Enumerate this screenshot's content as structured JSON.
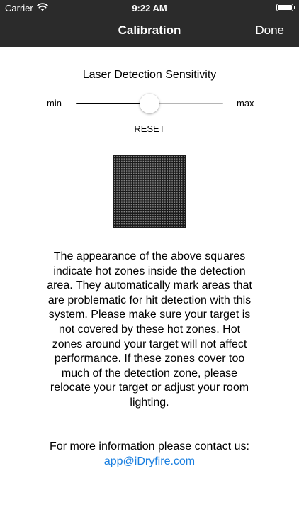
{
  "status_bar": {
    "carrier": "Carrier",
    "time": "9:22 AM",
    "wifi_icon": "wifi-icon",
    "battery_icon": "battery-icon",
    "battery_level": 1.0
  },
  "nav": {
    "title": "Calibration",
    "done_label": "Done",
    "background": "#2b2b2b"
  },
  "sensitivity": {
    "title": "Laser Detection Sensitivity",
    "min_label": "min",
    "max_label": "max",
    "value": 0.5,
    "reset_label": "RESET"
  },
  "hot_zones_preview": {
    "icon": "dotted-grid-square"
  },
  "description": "The appearance of the above squares indicate hot zones inside the detection area. They automatically mark areas that are problematic for hit detection with this system. Please make sure your target is not covered by these hot zones. Hot zones around your target will not affect performance. If these zones cover too much of the detection zone, please relocate your target or adjust your room lighting.",
  "contact": {
    "text": "For more information please contact us:",
    "email": "app@iDryfire.com",
    "link_color": "#1a7fe0"
  }
}
